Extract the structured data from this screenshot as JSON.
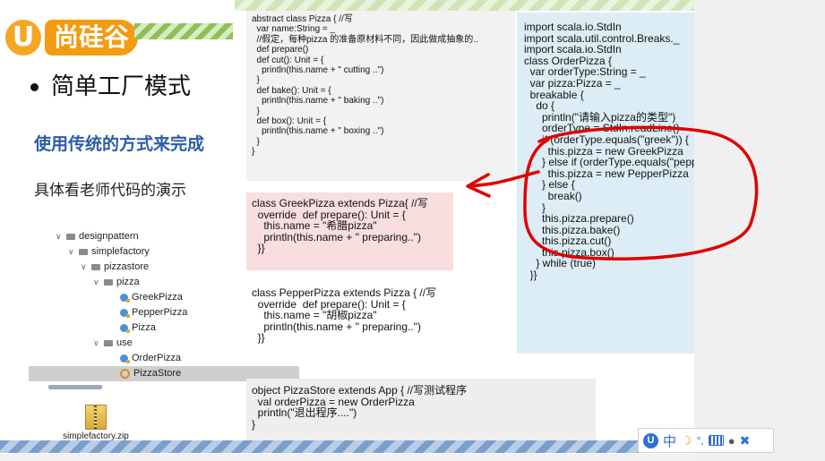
{
  "slide": {
    "logo": {
      "circle_letter": "U",
      "brand": "尚硅谷"
    },
    "bullet_title": "简单工厂模式",
    "subtitle": "使用传统的方式来完成",
    "description": "具体看老师代码的演示"
  },
  "project_tree": {
    "items": [
      {
        "label": "designpattern",
        "icon": "folder-icon",
        "expanded": true
      },
      {
        "label": "simplefactory",
        "icon": "folder-icon",
        "expanded": true
      },
      {
        "label": "pizzastore",
        "icon": "folder-icon",
        "expanded": true
      },
      {
        "label": "pizza",
        "icon": "folder-icon",
        "expanded": true
      },
      {
        "label": "GreekPizza",
        "icon": "scala-class-icon"
      },
      {
        "label": "PepperPizza",
        "icon": "scala-class-icon"
      },
      {
        "label": "Pizza",
        "icon": "scala-class-icon"
      },
      {
        "label": "use",
        "icon": "folder-icon",
        "expanded": true
      },
      {
        "label": "OrderPizza",
        "icon": "scala-class-icon"
      },
      {
        "label": "PizzaStore",
        "icon": "scala-object-icon",
        "selected": true
      }
    ]
  },
  "zip_file": {
    "label": "simplefactory.zip",
    "icon": "zip-archive-icon"
  },
  "code_blocks": {
    "abstract_pizza": "abstract class Pizza { //写\n  var name:String = _\n  //假定，每种pizza 的准备原材料不同，因此做成抽象的..\n  def prepare()\n  def cut(): Unit = {\n    println(this.name + \" cutting ..\")\n  }\n  def bake(): Unit = {\n    println(this.name + \" baking ..\")\n  }\n  def box(): Unit = {\n    println(this.name + \" boxing ..\")\n  }\n}",
    "greek_pizza": "class GreekPizza extends Pizza{ //写\n  override  def prepare(): Unit = {\n    this.name = \"希腊pizza\"\n    println(this.name + \" preparing..\")\n  }}",
    "pepper_pizza": "class PepperPizza extends Pizza { //写\n  override  def prepare(): Unit = {\n    this.name = \"胡椒pizza\"\n    println(this.name + \" preparing..\")\n  }}",
    "pizza_store": "object PizzaStore extends App { //写测试程序\n  val orderPizza = new OrderPizza\n  println(\"退出程序....\")\n}",
    "order_pizza": "import scala.io.StdIn\nimport scala.util.control.Breaks._\nimport scala.io.StdIn\nclass OrderPizza {\n  var orderType:String = _\n  var pizza:Pizza = _\n  breakable {\n    do {\n      println(\"请输入pizza的类型\")\n      orderType = StdIn.readLine()\n      if (orderType.equals(\"greek\")) {\n        this.pizza = new GreekPizza\n      } else if (orderType.equals(\"pepper\")) {\n        this.pizza = new PepperPizza\n      } else {\n        break()\n      }\n      this.pizza.prepare()\n      this.pizza.bake()\n      this.pizza.cut()\n      this.pizza.box()\n    } while (true)\n  }}"
  },
  "ime_toolbar": {
    "logo_letter": "U",
    "mode_char": "中",
    "items": [
      "ime-logo-icon",
      "chinese-mode-icon",
      "moon-icon",
      "punctuation-icon",
      "keyboard-icon",
      "user-icon",
      "wrench-icon"
    ]
  },
  "colors": {
    "brand_orange": "#f39c12",
    "subtitle_blue": "#2c5ca8",
    "greek_box": "#f8dede",
    "order_box": "#dcedf5",
    "annotation_red": "#e00000"
  }
}
